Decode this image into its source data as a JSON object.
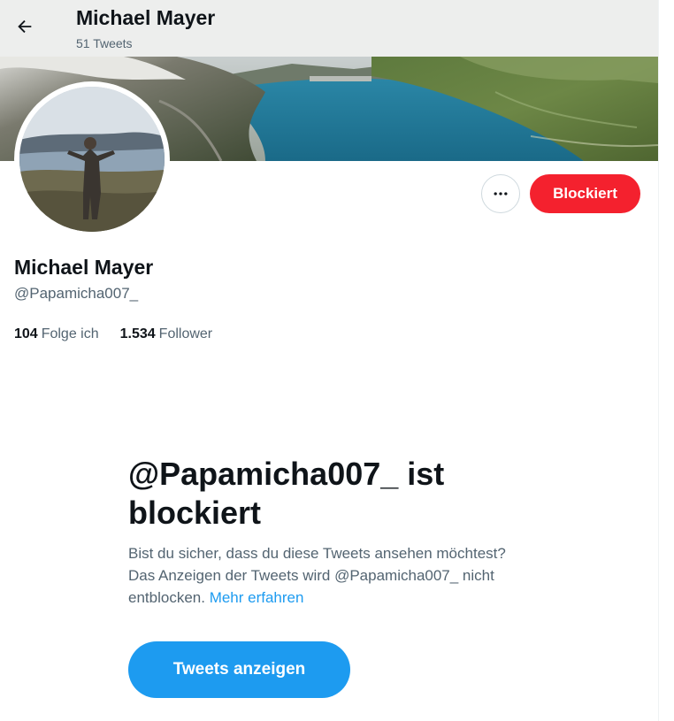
{
  "header": {
    "title": "Michael Mayer",
    "tweet_count": "51 Tweets"
  },
  "banner": {
    "description": "mountain-lake-banner"
  },
  "profile": {
    "name": "Michael Mayer",
    "handle": "@Papamicha007_",
    "following_count": "104",
    "following_label": "Folge ich",
    "followers_count": "1.534",
    "followers_label": "Follower"
  },
  "actions": {
    "more_icon": "more-horizontal-icon",
    "blocked_label": "Blockiert"
  },
  "blocked_notice": {
    "title": "@Papamicha007_ ist blockiert",
    "text": "Bist du sicher, dass du diese Tweets ansehen möchtest? Das Anzeigen der Tweets wird @Papamicha007_ nicht entblocken.",
    "link": "Mehr erfahren",
    "button_label": "Tweets anzeigen"
  },
  "colors": {
    "blocked_red": "#f4212e",
    "link_blue": "#1d9bf0",
    "secondary_text": "#536471"
  }
}
